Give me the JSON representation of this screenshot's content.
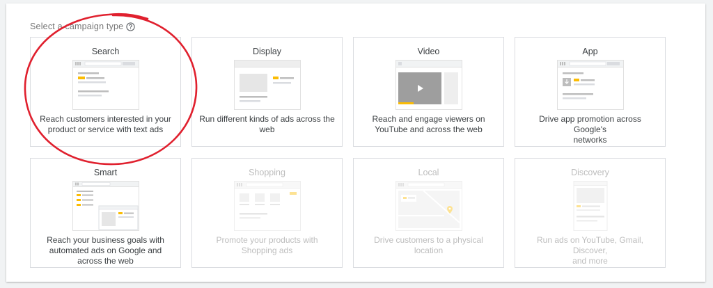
{
  "heading": "Select a campaign type",
  "colors": {
    "accent_yellow": "#fbbc04",
    "annotation_red": "#e0202e",
    "border": "#dadce0",
    "text": "#3c4043",
    "disabled_text": "#bdbdbd"
  },
  "cards": [
    {
      "title": "Search",
      "illustration": "search-ads-illustration",
      "desc_lines": [
        "Reach customers interested in your",
        "product or service with text ads"
      ],
      "disabled": false
    },
    {
      "title": "Display",
      "illustration": "display-ads-illustration",
      "desc_lines": [
        "Run different kinds of ads across the",
        "web"
      ],
      "disabled": false
    },
    {
      "title": "Video",
      "illustration": "video-ads-illustration",
      "desc_lines": [
        "Reach and engage viewers on",
        "YouTube and across the web"
      ],
      "disabled": false
    },
    {
      "title": "App",
      "illustration": "app-ads-illustration",
      "desc_lines": [
        "Drive app promotion across Google's",
        "networks"
      ],
      "disabled": false
    },
    {
      "title": "Smart",
      "illustration": "smart-ads-illustration",
      "desc_lines": [
        "Reach your business goals with",
        "automated ads on Google and",
        "across the web"
      ],
      "disabled": false
    },
    {
      "title": "Shopping",
      "illustration": "shopping-ads-illustration",
      "desc_lines": [
        "Promote your products with",
        "Shopping ads"
      ],
      "disabled": true
    },
    {
      "title": "Local",
      "illustration": "local-ads-illustration",
      "desc_lines": [
        "Drive customers to a physical",
        "location"
      ],
      "disabled": true
    },
    {
      "title": "Discovery",
      "illustration": "discovery-ads-illustration",
      "desc_lines": [
        "Run ads on YouTube, Gmail, Discover,",
        "and more"
      ],
      "disabled": true
    }
  ]
}
